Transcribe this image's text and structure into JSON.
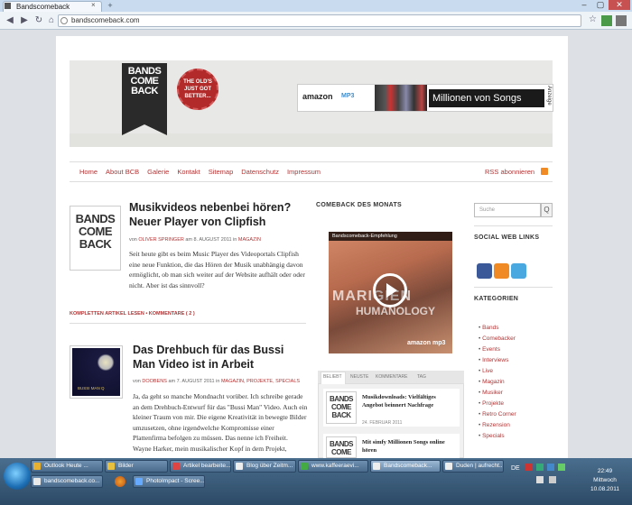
{
  "browser": {
    "tab_title": "Bandscomeback",
    "url": "bandscomeback.com",
    "window_controls": [
      "–",
      "▢",
      "✕"
    ]
  },
  "header": {
    "logo_lines": [
      "BANDS",
      "COME",
      "BACK"
    ],
    "badge_text": "THE OLD'S JUST GOT BETTER...",
    "ad": {
      "brand": "amazon",
      "service": "MP3",
      "headline": "Millionen von Songs",
      "label": "Anzeige"
    }
  },
  "nav": {
    "items": [
      "Home",
      "About BCB",
      "Galerie",
      "Kontakt",
      "Sitemap",
      "Datenschutz",
      "Impressum"
    ],
    "rss_label": "RSS abonnieren"
  },
  "posts": [
    {
      "title_line1": "Musikvideos nebenbei hören?",
      "title_line2": "Neuer Player von Clipfish",
      "meta_prefix": "von",
      "author": "OLIVER SPRINGER",
      "meta_mid": "am 8. AUGUST 2011 in",
      "category": "MAGAZIN",
      "body": "Seit heute gibt es beim Music Player des Videoportals Clipfish eine neue Funktion, die das Hören der Musik unabhängig davon ermöglicht, ob man sich weiter auf der Website aufhält oder oder nicht. Aber ist das sinnvoll?",
      "more": "KOMPLETTEN ARTIKEL LESEN • KOMMENTARE ( 2 )",
      "thumb_lines": [
        "BANDS",
        "COME",
        "BACK"
      ]
    },
    {
      "title_line1": "Das Drehbuch für das Bussi",
      "title_line2": "Man Video ist in Arbeit",
      "meta_prefix": "von",
      "author": "DOOBENS",
      "meta_mid": "am 7. AUGUST 2011 in",
      "category": "MAGAZIN, PROJEKTE, SPECIALS",
      "body": "Ja, da geht so manche Mondnacht vorüber. Ich schreibe gerade an dem Drehbuch-Entwurf für das \"Bussi Man\" Video. Auch ein kleiner Traum von mir. Die eigene Kreativität in bewegte Bilder umzusetzen, ohne irgendwelche Kompromisse einer Plattenfirma befolgen zu müssen. Das nenne ich Freiheit. Wayne Harker, mein musikalischer Kopf in dem Projekt,",
      "thumb_caption": "BUSSI MAN Q"
    }
  ],
  "middle": {
    "heading": "COMEBACK DES MONATS",
    "video_title": "Bandscomeback-Empfehlung",
    "video_text1": "MARIGIEN",
    "video_text2": "HUMANOLOGY",
    "video_brand": "amazon mp3",
    "tabs": [
      "BELIEBT",
      "NEUSTE",
      "KOMMENTARE",
      "TAG"
    ],
    "list": [
      {
        "title": "Musikdownloads: Vielfältiges Angebot beinnert Nachfrage",
        "date": "24. FEBRUAR 2011"
      },
      {
        "title": "Mit simfy Millionen Songs online hören",
        "date": ""
      }
    ]
  },
  "right": {
    "search_placeholder": "Suche",
    "search_button": "Q",
    "social_heading": "SOCIAL WEB LINKS",
    "categories_heading": "KATEGORIEN",
    "categories": [
      "Bands",
      "Comebacker",
      "Events",
      "Interviews",
      "Live",
      "Magazin",
      "Musiker",
      "Projekte",
      "Retro Corner",
      "Rezension",
      "Specials"
    ]
  },
  "taskbar": {
    "row1": [
      "Outlook Heute ...",
      "Bilder",
      "Artikel bearbeite...",
      "Blog über Zeitm...",
      "www.kaffeeraevi...",
      "Bandscomeback...",
      "Duden | aufrecht..."
    ],
    "row2": [
      "bandscomeback.co...",
      "",
      "PhotoImpact - Scree..."
    ],
    "lang": "DE",
    "time": "22:49",
    "day": "Mittwoch",
    "date": "10.08.2011"
  },
  "colors": {
    "accent": "#b13434",
    "rss": "#f08a24"
  }
}
